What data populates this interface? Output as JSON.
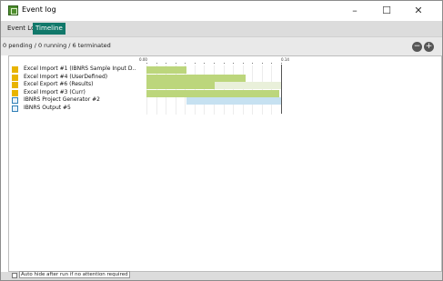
{
  "window": {
    "title": "Event log"
  },
  "window_controls": {
    "minimize": "–",
    "maximize": "☐",
    "close": "✕"
  },
  "tabs": [
    {
      "label": "Event Log",
      "selected": false
    },
    {
      "label": "Timeline",
      "selected": true
    }
  ],
  "status": {
    "text": "0 pending / 0 running / 6 terminated",
    "left_button_icon": "−",
    "right_button_icon": "+"
  },
  "timeline": {
    "tick_start": "0.00",
    "tick_end": "0.14"
  },
  "rows": [
    {
      "label": "Excel Import #1 (IBNRS Sample Input D...",
      "icon": "excel-icon",
      "bar_start": 0.0,
      "bar_end": 0.042,
      "bar_color": "#bcd67c",
      "ghost_end": null
    },
    {
      "label": "Excel Import #4 (UserDefined)",
      "icon": "excel-icon",
      "bar_start": 0.0,
      "bar_end": 0.103,
      "bar_color": "#bcd67c",
      "ghost_end": null
    },
    {
      "label": "Excel Export #6 (Results)",
      "icon": "excel-icon",
      "bar_start": 0.0,
      "bar_end": 0.071,
      "bar_color": "#bcd67c",
      "ghost_end": 0.14
    },
    {
      "label": "Excel Import #3 (Curr)",
      "icon": "excel-icon",
      "bar_start": 0.0,
      "bar_end": 0.138,
      "bar_color": "#bcd67c",
      "ghost_end": null
    },
    {
      "label": "IBNRS Project Generator #2",
      "icon": "generator-icon",
      "bar_start": 0.042,
      "bar_end": 0.14,
      "bar_color": "#c6e1f1",
      "ghost_end": null
    },
    {
      "label": "IBNRS Output #5",
      "icon": "generator-icon",
      "bar_start": null,
      "bar_end": null,
      "bar_color": "#c6e1f1",
      "ghost_end": null
    }
  ],
  "footer": {
    "auto_hide_label": "Auto hide after run if no attention required",
    "auto_hide_checked": false
  }
}
